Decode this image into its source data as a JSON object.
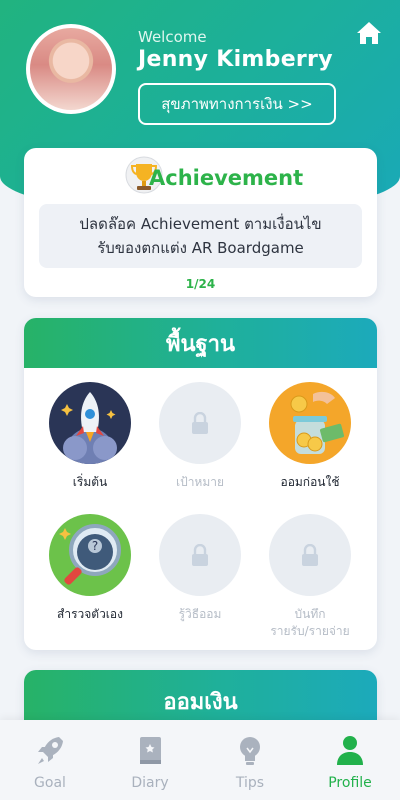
{
  "header": {
    "welcome": "Welcome",
    "user_name": "Jenny Kimberry",
    "finance_button": "สุขภาพทางการเงิน >>"
  },
  "achievement": {
    "title": "Achievement",
    "description_line1": "ปลดล๊อค Achievement ตามเงื่อนไข",
    "description_line2": "รับของตกแต่ง AR Boardgame",
    "progress": "1/24"
  },
  "basics": {
    "title": "พื้นฐาน",
    "items": [
      {
        "label": "เริ่มต้น",
        "locked": false,
        "icon": "rocket-icon"
      },
      {
        "label": "เป้าหมาย",
        "locked": true,
        "icon": "lock-icon"
      },
      {
        "label": "ออมก่อนใช้",
        "locked": false,
        "icon": "money-jar-icon"
      },
      {
        "label": "สำรวจตัวเอง",
        "locked": false,
        "icon": "magnifier-icon"
      },
      {
        "label": "รู้วิธีออม",
        "locked": true,
        "icon": "lock-icon"
      },
      {
        "label_line1": "บันทึก",
        "label_line2": "รายรับ/รายจ่าย",
        "locked": true,
        "icon": "lock-icon"
      }
    ]
  },
  "saving_section": {
    "title": "ออมเงิน"
  },
  "tabs": [
    {
      "label": "Goal",
      "icon": "rocket-icon",
      "active": false
    },
    {
      "label": "Diary",
      "icon": "book-icon",
      "active": false
    },
    {
      "label": "Tips",
      "icon": "lightbulb-icon",
      "active": false
    },
    {
      "label": "Profile",
      "icon": "person-icon",
      "active": true
    }
  ],
  "colors": {
    "primary_green": "#22b14c",
    "teal": "#1caabb",
    "inactive_gray": "#a9b1bd"
  }
}
